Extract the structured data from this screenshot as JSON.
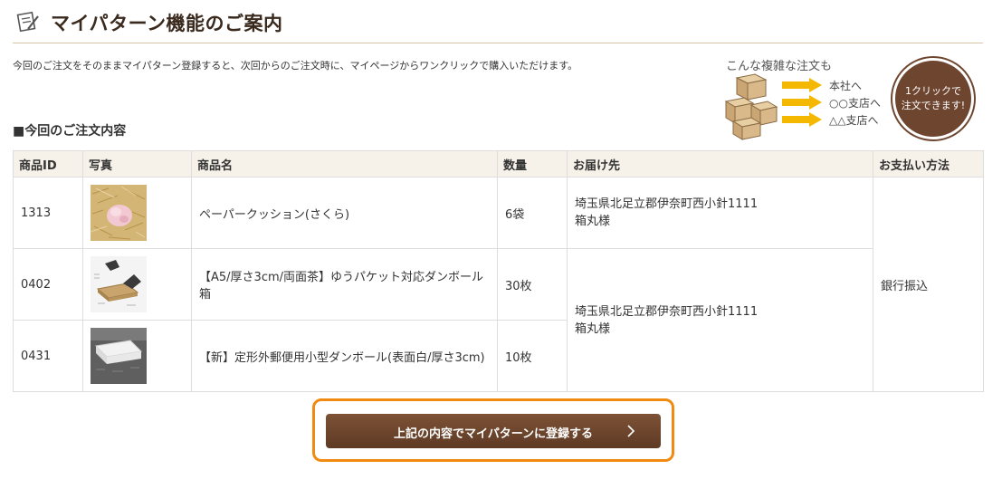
{
  "header": {
    "title": "マイパターン機能のご案内",
    "icon": "notepad-pencil-icon"
  },
  "intro": "今回のご注文をそのままマイパターン登録すると、次回からのご注文時に、マイページからワンクリックで購入いただけます。",
  "promo": {
    "caption": "こんな複雑な注文も",
    "destinations": [
      "本社へ",
      "○○支店へ",
      "△△支店へ"
    ],
    "badge_line1": "1クリックで",
    "badge_line2": "注文できます!",
    "colors": {
      "arrow": "#f5b800",
      "badge": "#6e4630"
    }
  },
  "section_title": "■今回のご注文内容",
  "table": {
    "headers": {
      "id": "商品ID",
      "photo": "写真",
      "name": "商品名",
      "qty": "数量",
      "dest": "お届け先",
      "payment": "お支払い方法"
    },
    "rows": [
      {
        "id": "1313",
        "photo": "paper-cushion-photo",
        "name": "ペーパークッション(さくら)",
        "qty": "6袋"
      },
      {
        "id": "0402",
        "photo": "a5-box-photo",
        "name": "【A5/厚さ3cm/両面茶】ゆうパケット対応ダンボール箱",
        "qty": "30枚"
      },
      {
        "id": "0431",
        "photo": "white-box-photo",
        "name": "【新】定形外郵便用小型ダンボール(表面白/厚さ3cm)",
        "qty": "10枚"
      }
    ],
    "destinations": [
      {
        "address": "埼玉県北足立郡伊奈町西小針1111",
        "recipient": "箱丸様"
      },
      {
        "address": "埼玉県北足立郡伊奈町西小針1111",
        "recipient": "箱丸様"
      }
    ],
    "payment": "銀行振込"
  },
  "cta": {
    "label": "上記の内容でマイパターンに登録する",
    "colors": {
      "button": "#6e4630",
      "focus_ring": "#f08a10"
    }
  }
}
